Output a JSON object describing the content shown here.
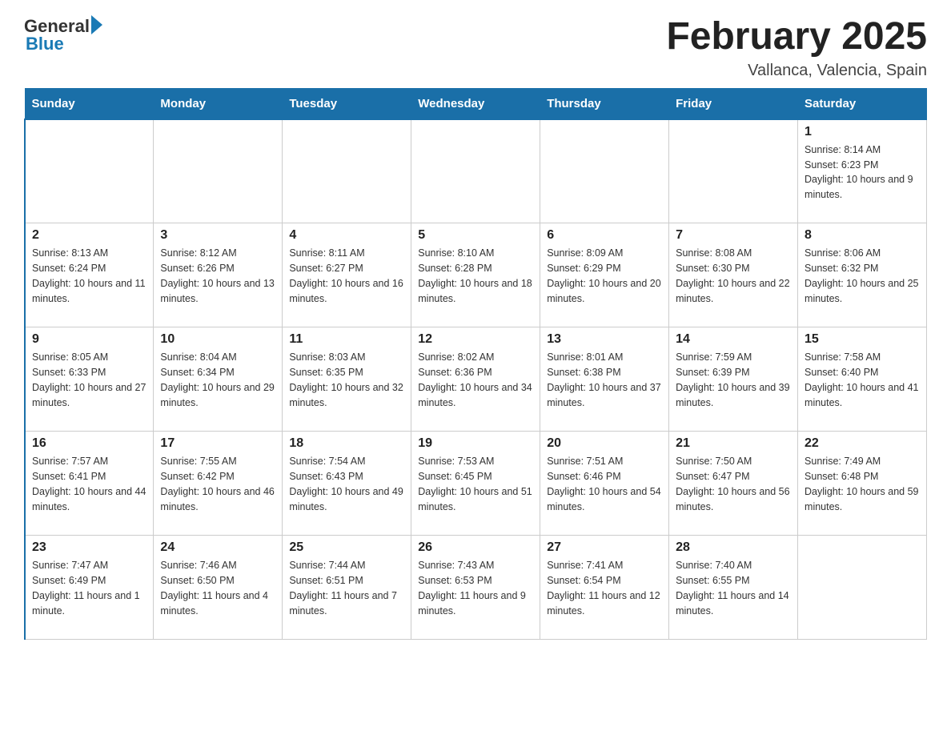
{
  "logo": {
    "general": "General",
    "blue": "Blue"
  },
  "title": "February 2025",
  "location": "Vallanca, Valencia, Spain",
  "days_of_week": [
    "Sunday",
    "Monday",
    "Tuesday",
    "Wednesday",
    "Thursday",
    "Friday",
    "Saturday"
  ],
  "weeks": [
    [
      {
        "day": "",
        "info": ""
      },
      {
        "day": "",
        "info": ""
      },
      {
        "day": "",
        "info": ""
      },
      {
        "day": "",
        "info": ""
      },
      {
        "day": "",
        "info": ""
      },
      {
        "day": "",
        "info": ""
      },
      {
        "day": "1",
        "info": "Sunrise: 8:14 AM\nSunset: 6:23 PM\nDaylight: 10 hours and 9 minutes."
      }
    ],
    [
      {
        "day": "2",
        "info": "Sunrise: 8:13 AM\nSunset: 6:24 PM\nDaylight: 10 hours and 11 minutes."
      },
      {
        "day": "3",
        "info": "Sunrise: 8:12 AM\nSunset: 6:26 PM\nDaylight: 10 hours and 13 minutes."
      },
      {
        "day": "4",
        "info": "Sunrise: 8:11 AM\nSunset: 6:27 PM\nDaylight: 10 hours and 16 minutes."
      },
      {
        "day": "5",
        "info": "Sunrise: 8:10 AM\nSunset: 6:28 PM\nDaylight: 10 hours and 18 minutes."
      },
      {
        "day": "6",
        "info": "Sunrise: 8:09 AM\nSunset: 6:29 PM\nDaylight: 10 hours and 20 minutes."
      },
      {
        "day": "7",
        "info": "Sunrise: 8:08 AM\nSunset: 6:30 PM\nDaylight: 10 hours and 22 minutes."
      },
      {
        "day": "8",
        "info": "Sunrise: 8:06 AM\nSunset: 6:32 PM\nDaylight: 10 hours and 25 minutes."
      }
    ],
    [
      {
        "day": "9",
        "info": "Sunrise: 8:05 AM\nSunset: 6:33 PM\nDaylight: 10 hours and 27 minutes."
      },
      {
        "day": "10",
        "info": "Sunrise: 8:04 AM\nSunset: 6:34 PM\nDaylight: 10 hours and 29 minutes."
      },
      {
        "day": "11",
        "info": "Sunrise: 8:03 AM\nSunset: 6:35 PM\nDaylight: 10 hours and 32 minutes."
      },
      {
        "day": "12",
        "info": "Sunrise: 8:02 AM\nSunset: 6:36 PM\nDaylight: 10 hours and 34 minutes."
      },
      {
        "day": "13",
        "info": "Sunrise: 8:01 AM\nSunset: 6:38 PM\nDaylight: 10 hours and 37 minutes."
      },
      {
        "day": "14",
        "info": "Sunrise: 7:59 AM\nSunset: 6:39 PM\nDaylight: 10 hours and 39 minutes."
      },
      {
        "day": "15",
        "info": "Sunrise: 7:58 AM\nSunset: 6:40 PM\nDaylight: 10 hours and 41 minutes."
      }
    ],
    [
      {
        "day": "16",
        "info": "Sunrise: 7:57 AM\nSunset: 6:41 PM\nDaylight: 10 hours and 44 minutes."
      },
      {
        "day": "17",
        "info": "Sunrise: 7:55 AM\nSunset: 6:42 PM\nDaylight: 10 hours and 46 minutes."
      },
      {
        "day": "18",
        "info": "Sunrise: 7:54 AM\nSunset: 6:43 PM\nDaylight: 10 hours and 49 minutes."
      },
      {
        "day": "19",
        "info": "Sunrise: 7:53 AM\nSunset: 6:45 PM\nDaylight: 10 hours and 51 minutes."
      },
      {
        "day": "20",
        "info": "Sunrise: 7:51 AM\nSunset: 6:46 PM\nDaylight: 10 hours and 54 minutes."
      },
      {
        "day": "21",
        "info": "Sunrise: 7:50 AM\nSunset: 6:47 PM\nDaylight: 10 hours and 56 minutes."
      },
      {
        "day": "22",
        "info": "Sunrise: 7:49 AM\nSunset: 6:48 PM\nDaylight: 10 hours and 59 minutes."
      }
    ],
    [
      {
        "day": "23",
        "info": "Sunrise: 7:47 AM\nSunset: 6:49 PM\nDaylight: 11 hours and 1 minute."
      },
      {
        "day": "24",
        "info": "Sunrise: 7:46 AM\nSunset: 6:50 PM\nDaylight: 11 hours and 4 minutes."
      },
      {
        "day": "25",
        "info": "Sunrise: 7:44 AM\nSunset: 6:51 PM\nDaylight: 11 hours and 7 minutes."
      },
      {
        "day": "26",
        "info": "Sunrise: 7:43 AM\nSunset: 6:53 PM\nDaylight: 11 hours and 9 minutes."
      },
      {
        "day": "27",
        "info": "Sunrise: 7:41 AM\nSunset: 6:54 PM\nDaylight: 11 hours and 12 minutes."
      },
      {
        "day": "28",
        "info": "Sunrise: 7:40 AM\nSunset: 6:55 PM\nDaylight: 11 hours and 14 minutes."
      },
      {
        "day": "",
        "info": ""
      }
    ]
  ]
}
